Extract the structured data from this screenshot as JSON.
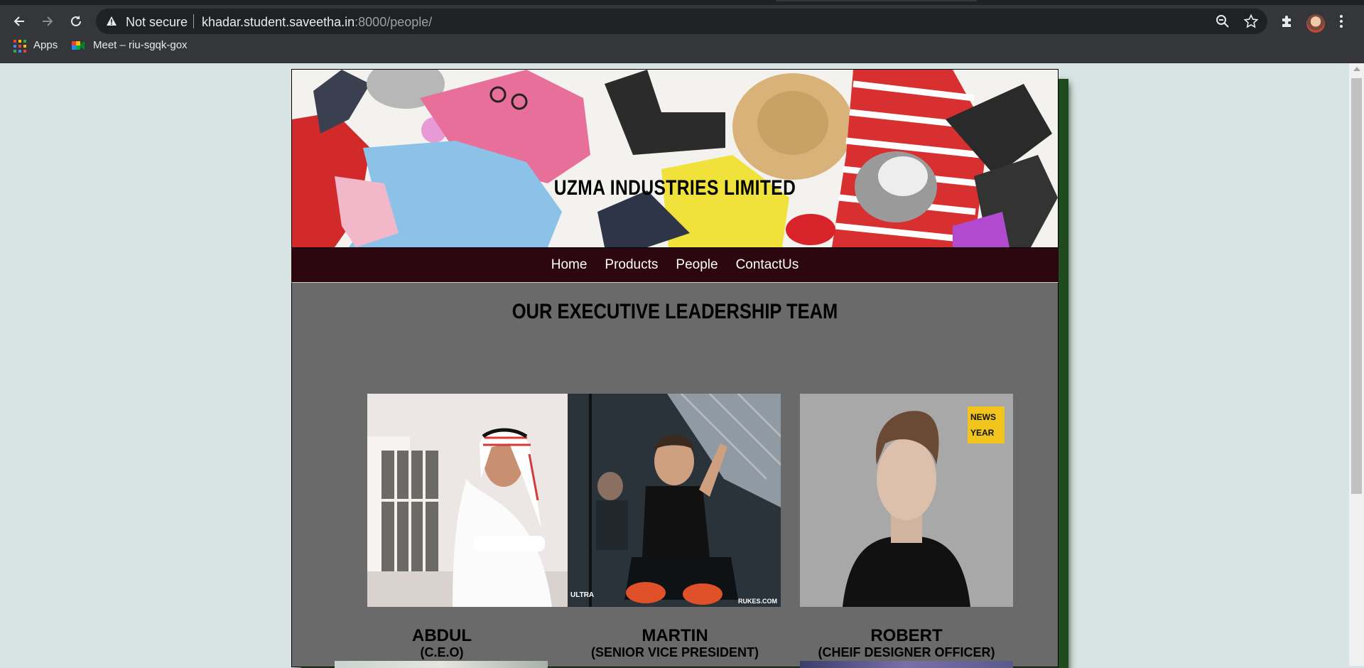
{
  "browser": {
    "security_status": "Not secure",
    "url_host": "khadar.student.saveetha.in",
    "url_rest": ":8000/people/",
    "bookmarks": [
      {
        "label": "Apps",
        "icon": "apps-grid-icon"
      },
      {
        "label": "Meet – riu-sgqk-gox",
        "icon": "google-meet-icon"
      }
    ]
  },
  "site": {
    "banner_title": "UZMA INDUSTRIES LIMITED",
    "nav": [
      "Home",
      "Products",
      "People",
      "ContactUs"
    ],
    "section_title": "OUR EXECUTIVE LEADERSHIP TEAM",
    "photo_watermarks": {
      "ultra": "ULTRA",
      "rukes": "RUKES.COM",
      "news_top": "NEWS",
      "news_bottom": "YEAR"
    },
    "people": [
      {
        "name": "ABDUL",
        "role": "(C.E.O)"
      },
      {
        "name": "MARTIN",
        "role": "(SENIOR VICE PRESIDENT)"
      },
      {
        "name": "ROBERT",
        "role": "(CHEIF DESIGNER OFFICER)"
      }
    ]
  },
  "colors": {
    "page_bg": "#d8e3e3",
    "nav_bg": "#2c0710",
    "content_bg": "#6a6a6a",
    "shadow": "#1f4a1f"
  }
}
